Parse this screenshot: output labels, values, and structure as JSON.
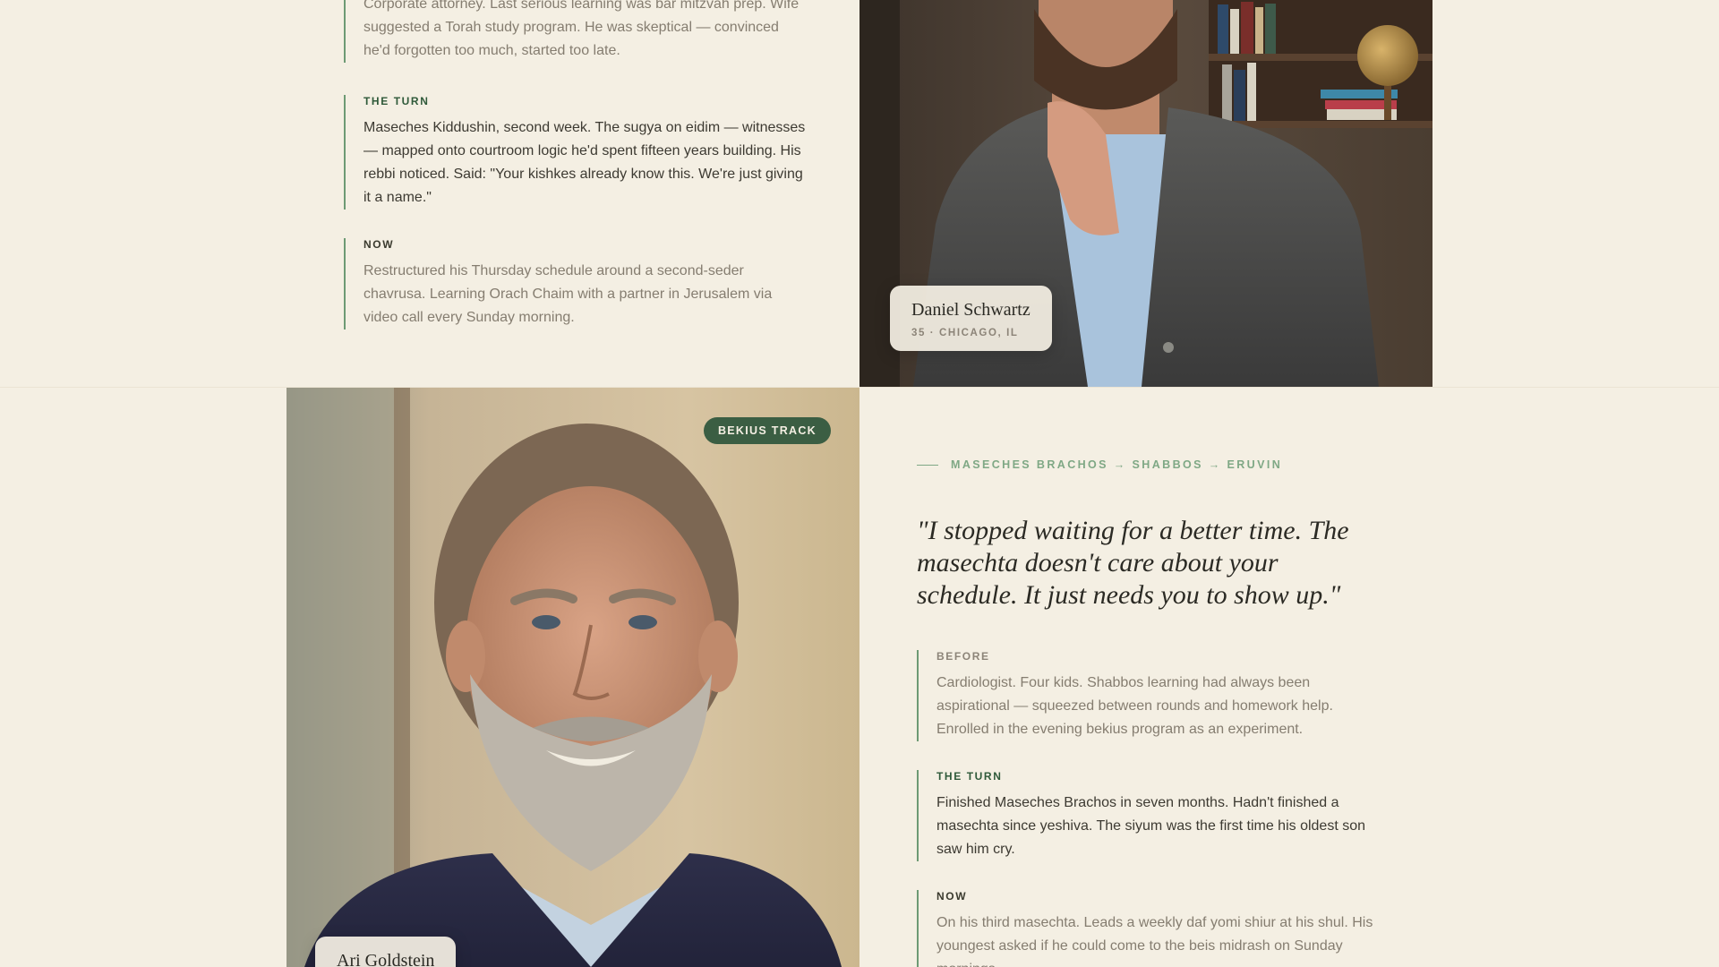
{
  "story1": {
    "before": {
      "body": "Corporate attorney. Last serious learning was bar mitzvah prep. Wife suggested a Torah study program. He was skeptical — convinced he'd forgotten too much, started too late."
    },
    "turn": {
      "label": "THE TURN",
      "body": "Maseches Kiddushin, second week. The sugya on eidim — witnesses — mapped onto courtroom logic he'd spent fifteen years building. His rebbi noticed. Said: \"Your kishkes already know this. We're just giving it a name.\""
    },
    "now": {
      "label": "NOW",
      "body": "Restructured his Thursday schedule around a second-seder chavrusa. Learning Orach Chaim with a partner in Jerusalem via video call every Sunday morning."
    },
    "person": {
      "name": "Daniel Schwartz",
      "meta": "35 · CHICAGO, IL"
    }
  },
  "story2": {
    "badge": "BEKIUS TRACK",
    "track": "MASECHES BRACHOS → SHABBOS → ERUVIN",
    "quote": "\"I stopped waiting for a better time. The masechta doesn't care about your schedule. It just needs you to show up.\"",
    "before": {
      "label": "BEFORE",
      "body": "Cardiologist. Four kids. Shabbos learning had always been aspirational — squeezed between rounds and homework help. Enrolled in the evening bekius program as an experiment."
    },
    "turn": {
      "label": "THE TURN",
      "body": "Finished Maseches Brachos in seven months. Hadn't finished a masechta since yeshiva. The siyum was the first time his oldest son saw him cry."
    },
    "now": {
      "label": "NOW",
      "body": "On his third masechta. Leads a weekly daf yomi shiur at his shul. His youngest asked if he could come to the beis midrash on Sunday mornings."
    },
    "person": {
      "name": "Ari Goldstein"
    }
  }
}
